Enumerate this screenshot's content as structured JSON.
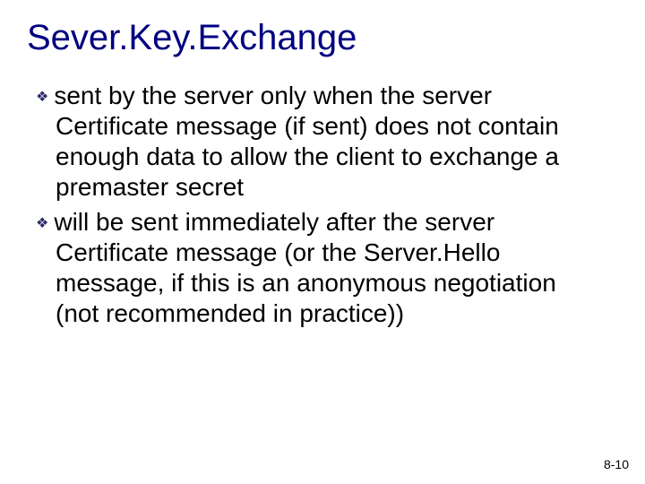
{
  "title": "Sever.Key.Exchange",
  "bullets": [
    "sent by the server only when the server Certificate message (if sent) does not contain enough data to allow the client to exchange a premaster secret",
    "will be sent immediately after the server Certificate message (or the Server.Hello message, if this is an anonymous negotiation (not recommended in practice))"
  ],
  "page_number": "8-10",
  "bullet_glyph": "❖"
}
